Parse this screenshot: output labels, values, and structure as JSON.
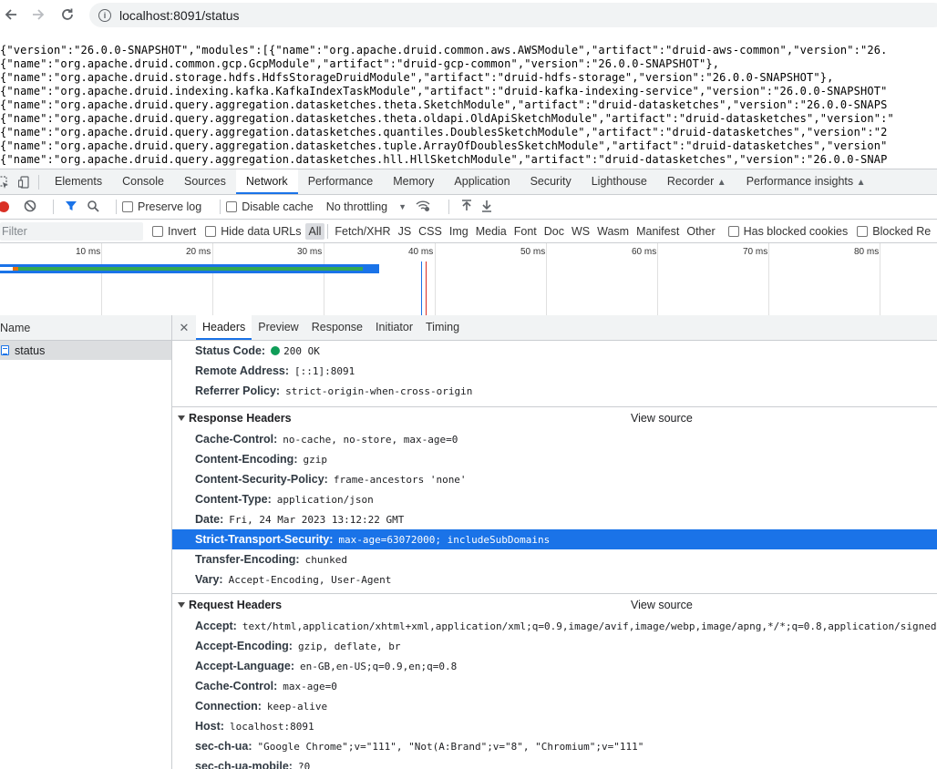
{
  "browser": {
    "url": "localhost:8091/status"
  },
  "page": {
    "json_lines": [
      "{\"version\":\"26.0.0-SNAPSHOT\",\"modules\":[{\"name\":\"org.apache.druid.common.aws.AWSModule\",\"artifact\":\"druid-aws-common\",\"version\":\"26.",
      "{\"name\":\"org.apache.druid.common.gcp.GcpModule\",\"artifact\":\"druid-gcp-common\",\"version\":\"26.0.0-SNAPSHOT\"},",
      "{\"name\":\"org.apache.druid.storage.hdfs.HdfsStorageDruidModule\",\"artifact\":\"druid-hdfs-storage\",\"version\":\"26.0.0-SNAPSHOT\"},",
      "{\"name\":\"org.apache.druid.indexing.kafka.KafkaIndexTaskModule\",\"artifact\":\"druid-kafka-indexing-service\",\"version\":\"26.0.0-SNAPSHOT\"",
      "{\"name\":\"org.apache.druid.query.aggregation.datasketches.theta.SketchModule\",\"artifact\":\"druid-datasketches\",\"version\":\"26.0.0-SNAPS",
      "{\"name\":\"org.apache.druid.query.aggregation.datasketches.theta.oldapi.OldApiSketchModule\",\"artifact\":\"druid-datasketches\",\"version\":\"",
      "{\"name\":\"org.apache.druid.query.aggregation.datasketches.quantiles.DoublesSketchModule\",\"artifact\":\"druid-datasketches\",\"version\":\"2",
      "{\"name\":\"org.apache.druid.query.aggregation.datasketches.tuple.ArrayOfDoublesSketchModule\",\"artifact\":\"druid-datasketches\",\"version\"",
      "{\"name\":\"org.apache.druid.query.aggregation.datasketches.hll.HllSketchModule\",\"artifact\":\"druid-datasketches\",\"version\":\"26.0.0-SNAP"
    ]
  },
  "devtools": {
    "tabs": [
      "Elements",
      "Console",
      "Sources",
      "Network",
      "Performance",
      "Memory",
      "Application",
      "Security",
      "Lighthouse",
      "Recorder",
      "Performance insights"
    ],
    "active_tab": "Network",
    "toolbar": {
      "preserve_log": "Preserve log",
      "disable_cache": "Disable cache",
      "throttling": "No throttling"
    },
    "filter": {
      "placeholder": "Filter",
      "invert": "Invert",
      "hide_data_urls": "Hide data URLs",
      "types": [
        "All",
        "Fetch/XHR",
        "JS",
        "CSS",
        "Img",
        "Media",
        "Font",
        "Doc",
        "WS",
        "Wasm",
        "Manifest",
        "Other"
      ],
      "active_type": "All",
      "has_blocked_cookies": "Has blocked cookies",
      "blocked_requests": "Blocked Re"
    },
    "timeline": {
      "ticks": [
        "10 ms",
        "20 ms",
        "30 ms",
        "40 ms",
        "50 ms",
        "60 ms",
        "70 ms",
        "80 ms"
      ]
    },
    "request_list": {
      "header": "Name",
      "requests": [
        "status"
      ]
    },
    "detail_tabs": [
      "Headers",
      "Preview",
      "Response",
      "Initiator",
      "Timing"
    ],
    "active_detail_tab": "Headers",
    "general": [
      {
        "name": "Status Code:",
        "value": "200 OK"
      },
      {
        "name": "Remote Address:",
        "value": "[::1]:8091"
      },
      {
        "name": "Referrer Policy:",
        "value": "strict-origin-when-cross-origin"
      }
    ],
    "response_headers_title": "Response Headers",
    "request_headers_title": "Request Headers",
    "view_source": "View source",
    "response_headers": [
      {
        "name": "Cache-Control:",
        "value": "no-cache, no-store, max-age=0"
      },
      {
        "name": "Content-Encoding:",
        "value": "gzip"
      },
      {
        "name": "Content-Security-Policy:",
        "value": "frame-ancestors 'none'"
      },
      {
        "name": "Content-Type:",
        "value": "application/json"
      },
      {
        "name": "Date:",
        "value": "Fri, 24 Mar 2023 13:12:22 GMT"
      },
      {
        "name": "Strict-Transport-Security:",
        "value": "max-age=63072000; includeSubDomains"
      },
      {
        "name": "Transfer-Encoding:",
        "value": "chunked"
      },
      {
        "name": "Vary:",
        "value": "Accept-Encoding, User-Agent"
      }
    ],
    "request_headers": [
      {
        "name": "Accept:",
        "value": "text/html,application/xhtml+xml,application/xml;q=0.9,image/avif,image/webp,image/apng,*/*;q=0.8,application/signed-"
      },
      {
        "name": "Accept-Encoding:",
        "value": "gzip, deflate, br"
      },
      {
        "name": "Accept-Language:",
        "value": "en-GB,en-US;q=0.9,en;q=0.8"
      },
      {
        "name": "Cache-Control:",
        "value": "max-age=0"
      },
      {
        "name": "Connection:",
        "value": "keep-alive"
      },
      {
        "name": "Host:",
        "value": "localhost:8091"
      },
      {
        "name": "sec-ch-ua:",
        "value": "\"Google Chrome\";v=\"111\", \"Not(A:Brand\";v=\"8\", \"Chromium\";v=\"111\""
      },
      {
        "name": "sec-ch-ua-mobile:",
        "value": "?0"
      }
    ],
    "colors": {
      "accent": "#1a73e8",
      "status_ok": "#0f9d58",
      "record": "#d93025"
    }
  }
}
